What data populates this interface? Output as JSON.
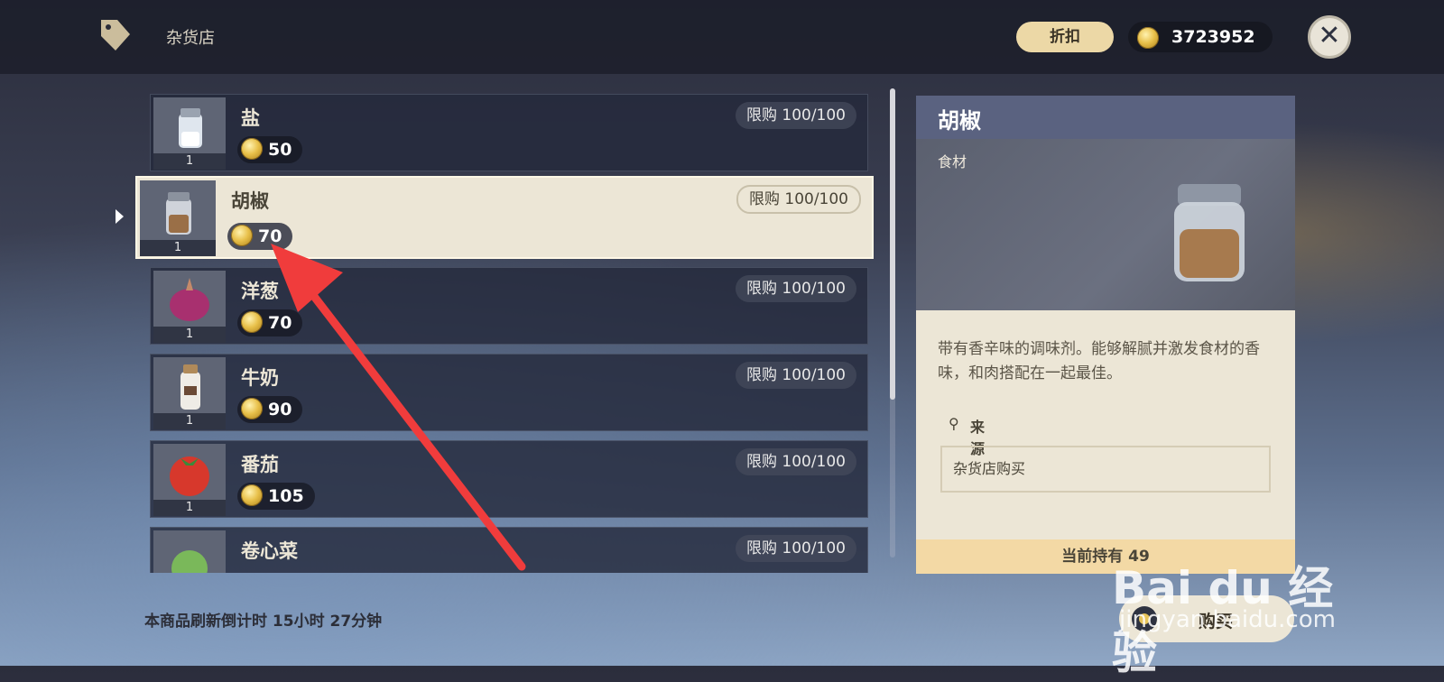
{
  "header": {
    "shop_title": "杂货店",
    "discount_label": "折扣",
    "currency_value": "3723952"
  },
  "items": [
    {
      "name": "盐",
      "price": "50",
      "qty": "1",
      "limit": "限购 100/100"
    },
    {
      "name": "胡椒",
      "price": "70",
      "qty": "1",
      "limit": "限购 100/100",
      "selected": true
    },
    {
      "name": "洋葱",
      "price": "70",
      "qty": "1",
      "limit": "限购 100/100"
    },
    {
      "name": "牛奶",
      "price": "90",
      "qty": "1",
      "limit": "限购 100/100"
    },
    {
      "name": "番茄",
      "price": "105",
      "qty": "1",
      "limit": "限购 100/100"
    },
    {
      "name": "卷心菜",
      "price": "",
      "qty": "",
      "limit": "限购 100/100"
    }
  ],
  "detail": {
    "name": "胡椒",
    "category": "食材",
    "description": "带有香辛味的调味剂。能够解腻并激发食材的香味，和肉搭配在一起最佳。",
    "source_label": "来源",
    "source_value": "杂货店购买",
    "owned": "当前持有 49"
  },
  "footer": {
    "refresh_text": "本商品刷新倒计时 15小时 27分钟",
    "buy_label": "购买"
  },
  "watermark": {
    "brand": "Bai du 经验",
    "url": "jingyan.baidu.com"
  },
  "colors": {
    "accent_gold": "#ecd8a6",
    "annotation_arrow": "#f03c3c"
  }
}
